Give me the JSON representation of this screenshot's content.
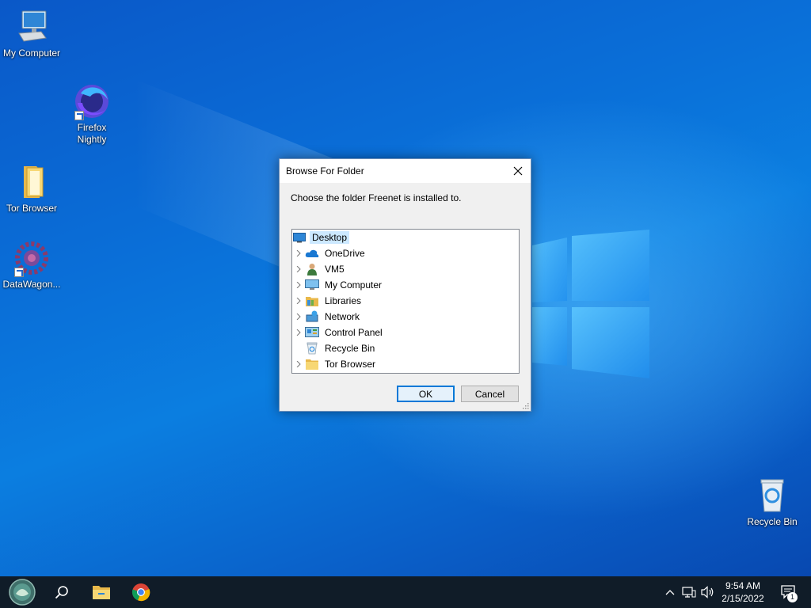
{
  "desktop": {
    "icons": [
      {
        "label": "My Computer"
      },
      {
        "label": "Firefox Nightly"
      },
      {
        "label": "Tor Browser"
      },
      {
        "label": "DataWagon..."
      },
      {
        "label": "Recycle Bin"
      }
    ]
  },
  "dialog": {
    "title": "Browse For Folder",
    "prompt": "Choose the folder Freenet is installed to.",
    "tree": [
      {
        "label": "Desktop",
        "icon": "desktop-icon",
        "selected": true
      },
      {
        "label": "OneDrive",
        "icon": "onedrive-cloud-icon"
      },
      {
        "label": "VM5",
        "icon": "user-icon"
      },
      {
        "label": "My Computer",
        "icon": "computer-icon"
      },
      {
        "label": "Libraries",
        "icon": "libraries-icon"
      },
      {
        "label": "Network",
        "icon": "network-icon"
      },
      {
        "label": "Control Panel",
        "icon": "control-panel-icon"
      },
      {
        "label": "Recycle Bin",
        "icon": "recycle-bin-icon"
      },
      {
        "label": "Tor Browser",
        "icon": "folder-icon"
      }
    ],
    "ok_label": "OK",
    "cancel_label": "Cancel"
  },
  "taskbar": {
    "time": "9:54 AM",
    "date": "2/15/2022",
    "notification_count": "1"
  },
  "colors": {
    "accent": "#0078d7",
    "taskbar": "#101c28",
    "selection": "#cce8ff"
  }
}
